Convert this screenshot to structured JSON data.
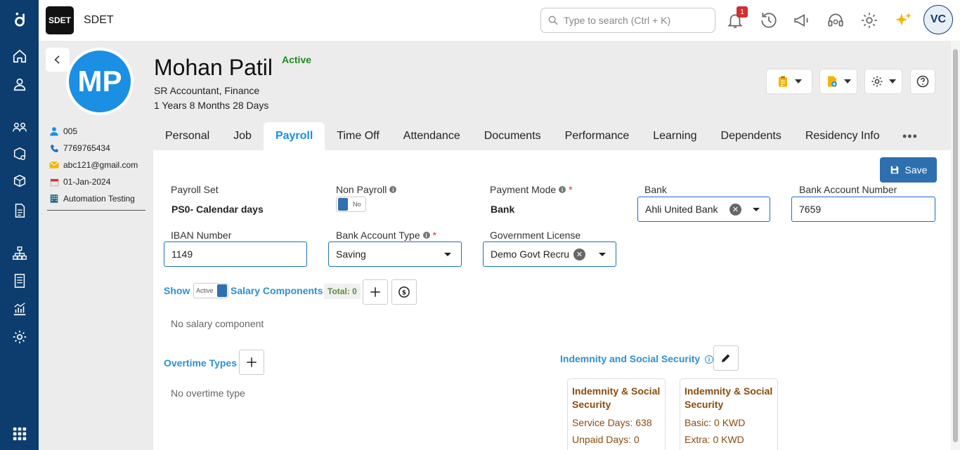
{
  "app": {
    "logo_text": "SDET",
    "title": "SDET"
  },
  "search": {
    "placeholder": "Type to search (Ctrl + K)"
  },
  "notifications": {
    "count": "1"
  },
  "user": {
    "initials": "VC"
  },
  "employee": {
    "initials": "MP",
    "name": "Mohan Patil",
    "status": "Active",
    "title": "SR Accountant, Finance",
    "tenure": "1 Years 8 Months 28 Days",
    "id": "005",
    "phone": "7769765434",
    "email": "abc121@gmail.com",
    "join_date": "01-Jan-2024",
    "company": "Automation Testing"
  },
  "tabs": [
    "Personal",
    "Job",
    "Payroll",
    "Time Off",
    "Attendance",
    "Documents",
    "Performance",
    "Learning",
    "Dependents",
    "Residency Info"
  ],
  "tab_more": "•••",
  "save_label": "Save",
  "form": {
    "payroll_set": {
      "label": "Payroll Set",
      "value": "PS0- Calendar days"
    },
    "non_payroll": {
      "label": "Non Payroll",
      "toggle": "No"
    },
    "payment_mode": {
      "label": "Payment Mode",
      "value": "Bank",
      "required": "*"
    },
    "bank": {
      "label": "Bank",
      "value": "Ahli United Bank"
    },
    "bank_account_number": {
      "label": "Bank Account Number",
      "value": "7659"
    },
    "iban": {
      "label": "IBAN Number",
      "value": "1149"
    },
    "bank_account_type": {
      "label": "Bank Account Type",
      "value": "Saving",
      "required": "*"
    },
    "gov_license": {
      "label": "Government License",
      "value": "Demo Govt Recru"
    }
  },
  "salary": {
    "show_label": "Show",
    "toggle": "Active",
    "title": "Salary Components",
    "total": "Total: 0",
    "empty": "No salary component"
  },
  "overtime": {
    "title": "Overtime Types",
    "empty": "No overtime type"
  },
  "indemnity": {
    "title": "Indemnity and Social Security",
    "cards": [
      {
        "title": "Indemnity & Social Security",
        "line1": "Service Days: 638",
        "line2": "Unpaid Days: 0"
      },
      {
        "title": "Indemnity & Social Security",
        "line1": "Basic: 0 KWD",
        "line2": "Extra: 0 KWD"
      }
    ]
  },
  "colors": {
    "sidebar": "#0d3d6e",
    "accent": "#1a8fe3",
    "status_active": "#1c8a1c",
    "save_button": "#2e6fb0"
  }
}
